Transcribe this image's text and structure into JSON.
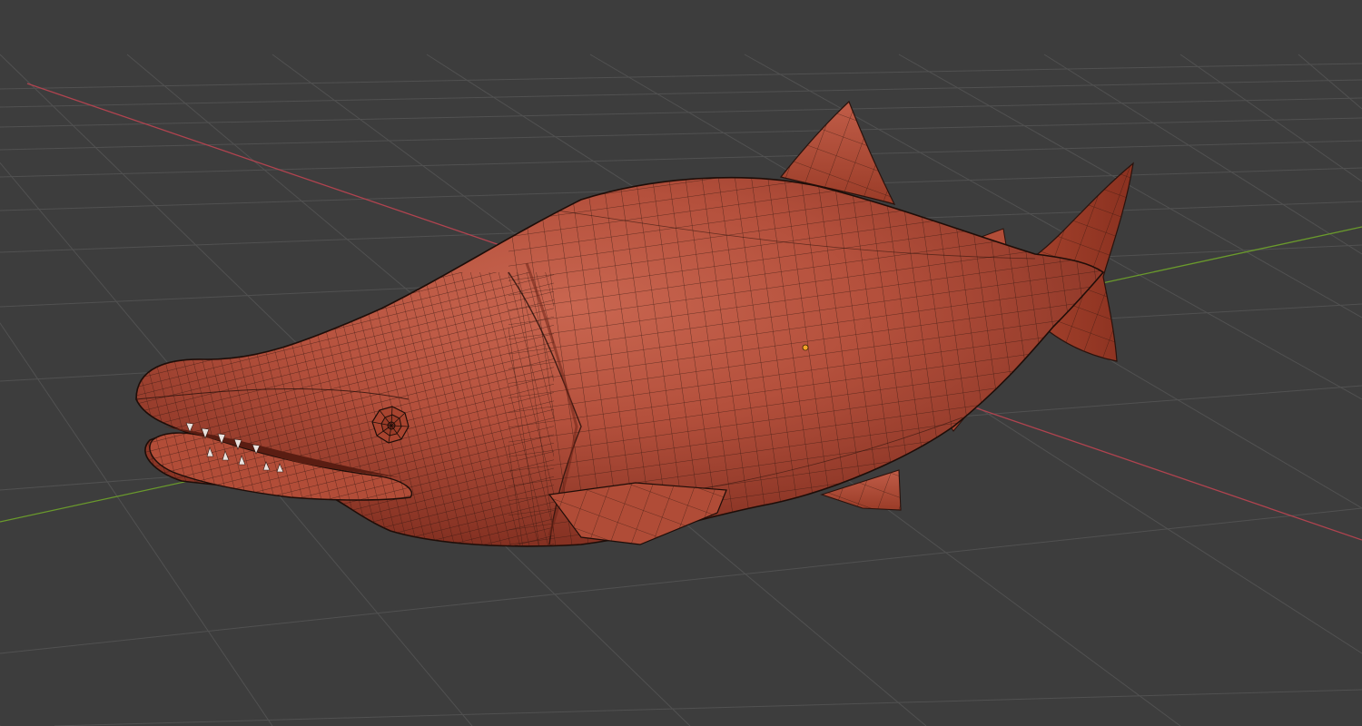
{
  "viewport": {
    "type": "3d-viewport",
    "background_color": "#3d3d3d",
    "grid_color": "#555555",
    "x_axis_color": "#b0434f",
    "y_axis_color": "#6a9a2c",
    "grid_visible": true
  },
  "object": {
    "name": "salmon-mesh",
    "shading": "solid",
    "wireframe_overlay": true,
    "surface_color": "#b4503c",
    "edge_color": "#2a120c"
  },
  "origin": {
    "name": "object-origin",
    "color": "#f3a42a"
  }
}
